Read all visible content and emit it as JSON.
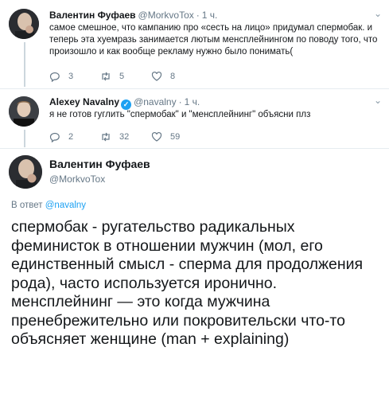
{
  "tweets": [
    {
      "name": "Валентин Фуфаев",
      "handle": "@MorkvoTox",
      "time": "1 ч.",
      "text": "самое смешное, что кампанию про «сесть на лицо» придумал спермобак. и теперь эта хуемразь занимается лютым менсплейнингом по поводу того, что произошло и как вообще рекламу нужно было понимать(",
      "replies": "3",
      "retweets": "5",
      "likes": "8"
    },
    {
      "name": "Alexey Navalny",
      "handle": "@navalny",
      "time": "1 ч.",
      "text": "я не готов гуглить \"спермобак\" и \"менсплейнинг\" объясни плз",
      "replies": "2",
      "retweets": "32",
      "likes": "59"
    }
  ],
  "main": {
    "name": "Валентин Фуфаев",
    "handle": "@MorkvoTox",
    "reply_prefix": "В ответ",
    "reply_handle": "@navalny",
    "text": "спермобак - ругательство радикальных феминисток в отношении мужчин (мол, его единственный смысл - сперма для продолжения рода), часто используется иронично. менсплейнинг — это когда мужчина пренебрежительно или покровительски что-то объясняет женщине (man + explaining)"
  },
  "colors": {
    "link": "#1da1f2",
    "muted": "#657786",
    "verified": "#1da1f2"
  },
  "icons": [
    "reply-icon",
    "retweet-icon",
    "like-icon",
    "chevron-down-icon",
    "verified-icon"
  ]
}
